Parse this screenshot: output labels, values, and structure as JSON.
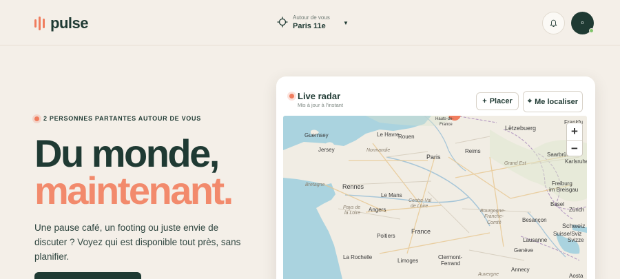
{
  "header": {
    "logo_text": "pulse",
    "location_label": "Autour de vous",
    "location_value": "Paris 11e",
    "location_icon": "crosshair-icon",
    "chevron_icon": "chevron-down-icon",
    "notification_icon": "bell-icon",
    "avatar_initial": "o",
    "online_color": "#7fc46a"
  },
  "hero": {
    "eyebrow": "2 PERSONNES PARTANTES AUTOUR DE VOUS",
    "headline_line1": "Du monde,",
    "headline_line2": "maintenant.",
    "lead": "Une pause café, un footing ou juste envie de discuter ? Voyez qui est disponible tout près, sans planifier."
  },
  "radar": {
    "title": "Live radar",
    "subtitle": "Mis à jour à l'instant",
    "place_icon": "+",
    "place_label": "Placer",
    "locate_icon": "⌖",
    "locate_label": "Me localiser",
    "zoom_in": "+",
    "zoom_out": "−"
  },
  "map_labels": {
    "guernsey": "Guernsey",
    "jersey": "Jersey",
    "le_havre": "Le Havre",
    "rouen": "Rouen",
    "hauts_de_france_1": "Hauts-de-",
    "hauts_de_france_2": "France",
    "normandie": "Normandie",
    "paris": "Paris",
    "reims": "Reims",
    "letzebuerg": "Lëtzebuerg",
    "frankfurt": "Frankfu",
    "saarbrucken": "Saarbrücken",
    "grand_est": "Grand Est",
    "karlsruhe": "Karlsruhe",
    "bretagne": "Bretagne",
    "rennes": "Rennes",
    "le_mans": "Le Mans",
    "centre_val_de_loire_1": "Centre-Val",
    "centre_val_de_loire_2": "de Loire",
    "freiburg_1": "Freiburg",
    "freiburg_2": "im Breisgau",
    "pays_de_la_loire_1": "Pays de",
    "pays_de_la_loire_2": "la Loire",
    "angers": "Angers",
    "bourgogne_1": "Bourgogne-",
    "bourgogne_2": "Franche-",
    "bourgogne_3": "Comté",
    "basel": "Basel",
    "zurich": "Zürich",
    "besancon": "Besançon",
    "schweiz": "Schweiz",
    "france": "France",
    "lausanne": "Lausanne",
    "suisse_1": "Suisse/Sviz",
    "suisse_2": "Svizze",
    "poitiers": "Poitiers",
    "la_rochelle": "La Rochelle",
    "limoges": "Limoges",
    "clermont_1": "Clermont-",
    "clermont_2": "Ferrand",
    "geneve": "Genève",
    "annecy": "Annecy",
    "auvergne": "Auvergne",
    "aosta": "Aosta"
  }
}
